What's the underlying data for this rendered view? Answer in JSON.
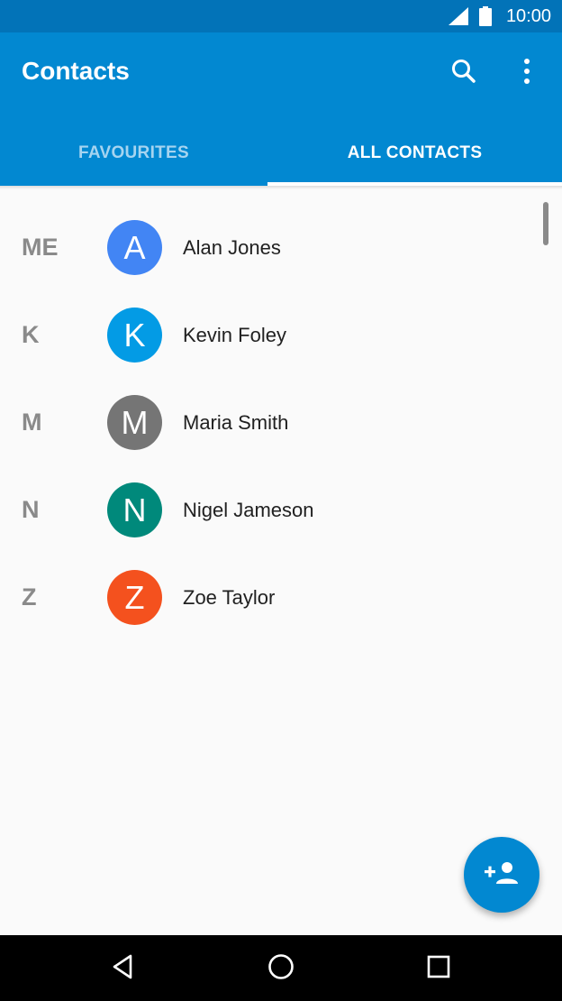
{
  "status_bar": {
    "time": "10:00"
  },
  "app_bar": {
    "title": "Contacts",
    "search_icon": "search-icon",
    "more_icon": "more-vert-icon"
  },
  "tabs": [
    {
      "label": "FAVOURITES",
      "selected": false
    },
    {
      "label": "ALL CONTACTS",
      "selected": true
    }
  ],
  "contacts": [
    {
      "section": "ME",
      "initial": "A",
      "name": "Alan Jones",
      "color": "#4285f4"
    },
    {
      "section": "K",
      "initial": "K",
      "name": "Kevin Foley",
      "color": "#039be5"
    },
    {
      "section": "M",
      "initial": "M",
      "name": "Maria Smith",
      "color": "#757575"
    },
    {
      "section": "N",
      "initial": "N",
      "name": "Nigel Jameson",
      "color": "#00897b"
    },
    {
      "section": "Z",
      "initial": "Z",
      "name": "Zoe Taylor",
      "color": "#f4511e"
    }
  ],
  "fab": {
    "icon": "add-person-icon"
  },
  "colors": {
    "status_bar": "#0273b8",
    "app_bar": "#0288d1",
    "background": "#fafafa"
  }
}
